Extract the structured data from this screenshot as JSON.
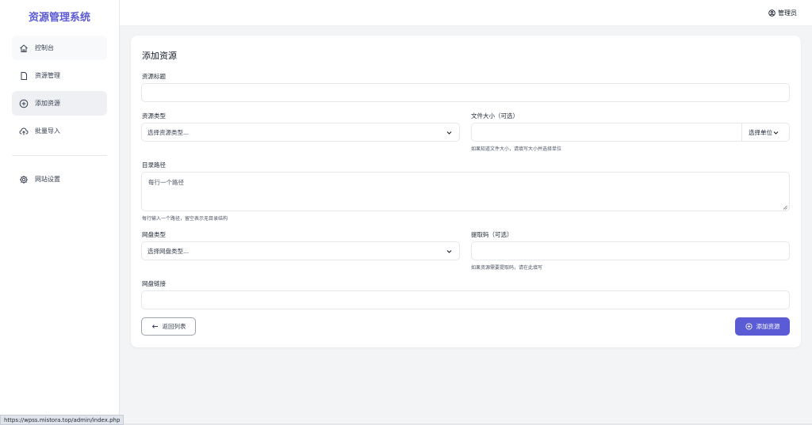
{
  "app": {
    "brand": "资源管理系统"
  },
  "sidebar": {
    "items": [
      {
        "label": "控制台",
        "icon": "home-icon"
      },
      {
        "label": "资源管理",
        "icon": "file-icon"
      },
      {
        "label": "添加资源",
        "icon": "plus-circle-icon",
        "active": true
      },
      {
        "label": "批量导入",
        "icon": "cloud-upload-icon"
      },
      {
        "label": "网站设置",
        "icon": "gear-icon"
      }
    ]
  },
  "header": {
    "user_label": "管理员",
    "user_icon": "user-circle-icon"
  },
  "form": {
    "title": "添加资源",
    "title_field": {
      "label": "资源标题",
      "value": ""
    },
    "type_field": {
      "label": "资源类型",
      "selected": "选择资源类型..."
    },
    "size_field": {
      "label": "文件大小（可选）",
      "value": "",
      "unit_selected": "选择单位",
      "hint": "如果知道文件大小，请填写大小并选择单位"
    },
    "path_field": {
      "label": "目录路径",
      "placeholder": "每行一个路径",
      "hint": "每行输入一个路径，留空表示无目录结构"
    },
    "disk_type_field": {
      "label": "网盘类型",
      "selected": "选择网盘类型..."
    },
    "code_field": {
      "label": "提取码（可选）",
      "value": "",
      "hint": "如果资源需要提取码，请在此填写"
    },
    "link_field": {
      "label": "网盘链接",
      "value": ""
    },
    "back_button": "返回列表",
    "submit_button": "添加资源"
  },
  "status_bar": {
    "url": "https://wpss.mistora.top/admin/index.php"
  },
  "colors": {
    "accent": "#5b5bd6",
    "background": "#f3f4f6"
  }
}
